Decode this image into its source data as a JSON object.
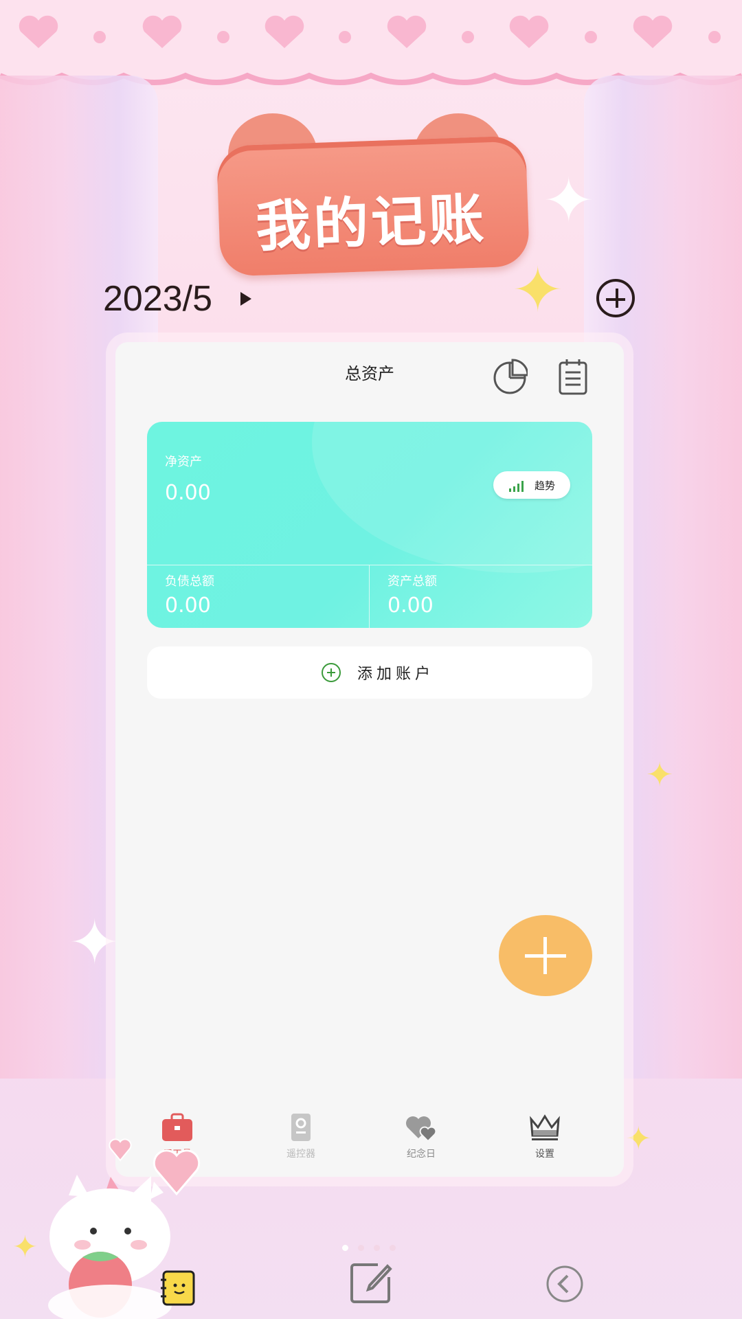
{
  "widget": {
    "title": "我的记账",
    "date": "2023/5"
  },
  "panel": {
    "header_title": "总资产",
    "asset_card": {
      "net_assets_label": "净资产",
      "net_assets_value": "0.00",
      "trend_label": "趋势",
      "liabilities_label": "负债总额",
      "liabilities_value": "0.00",
      "total_assets_label": "资产总额",
      "total_assets_value": "0.00"
    },
    "add_account_label": "添加账户",
    "tabs": [
      {
        "label": "用工具",
        "icon": "toolbox-icon",
        "color": "#e25b5b"
      },
      {
        "label": "遥控器",
        "icon": "remote-icon",
        "color": "#b9b9b9"
      },
      {
        "label": "纪念日",
        "icon": "hearts-icon",
        "color": "#8a8a8a"
      },
      {
        "label": "设置",
        "icon": "crown-icon",
        "color": "#555555"
      }
    ]
  },
  "pager": {
    "pages": 4,
    "active": 1
  },
  "colors": {
    "card_teal": "#6ff2e2",
    "fab_orange": "#f8bd67",
    "badge_coral": "#f07e6a"
  }
}
